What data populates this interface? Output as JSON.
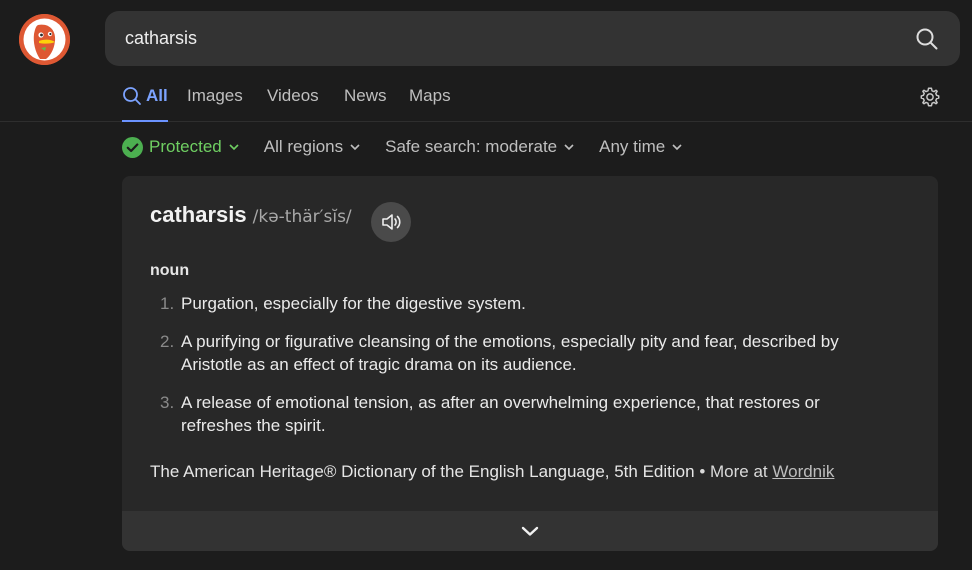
{
  "search": {
    "query": "catharsis"
  },
  "tabs": [
    {
      "label": "All",
      "active": true
    },
    {
      "label": "Images"
    },
    {
      "label": "Videos"
    },
    {
      "label": "News"
    },
    {
      "label": "Maps"
    }
  ],
  "filters": {
    "protected": "Protected",
    "regions": "All regions",
    "safe_search": "Safe search: moderate",
    "time": "Any time"
  },
  "definition": {
    "word": "catharsis",
    "pronunciation": "/kə-thär′sĭs/",
    "part_of_speech": "noun",
    "senses": [
      {
        "num": "1.",
        "text": "Purgation, especially for the digestive system."
      },
      {
        "num": "2.",
        "text": "A purifying or figurative cleansing of the emotions, especially pity and fear, described by Aristotle as an effect of tragic drama on its audience."
      },
      {
        "num": "3.",
        "text": "A release of emotional tension, as after an overwhelming experience, that restores or refreshes the spirit."
      }
    ],
    "source": "The American Heritage® Dictionary of the English Language, 5th Edition",
    "more_prefix": "More at",
    "more_link": "Wordnik"
  },
  "icons": {
    "logo": "duckduckgo-logo",
    "search": "search-icon",
    "gear": "gear-icon",
    "check": "check-circle-icon",
    "chevron": "chevron-down-icon",
    "speaker": "speaker-icon"
  },
  "colors": {
    "background": "#1c1c1c",
    "accent": "#7ca3ff",
    "protected": "#6fcf62",
    "card": "#282828"
  }
}
